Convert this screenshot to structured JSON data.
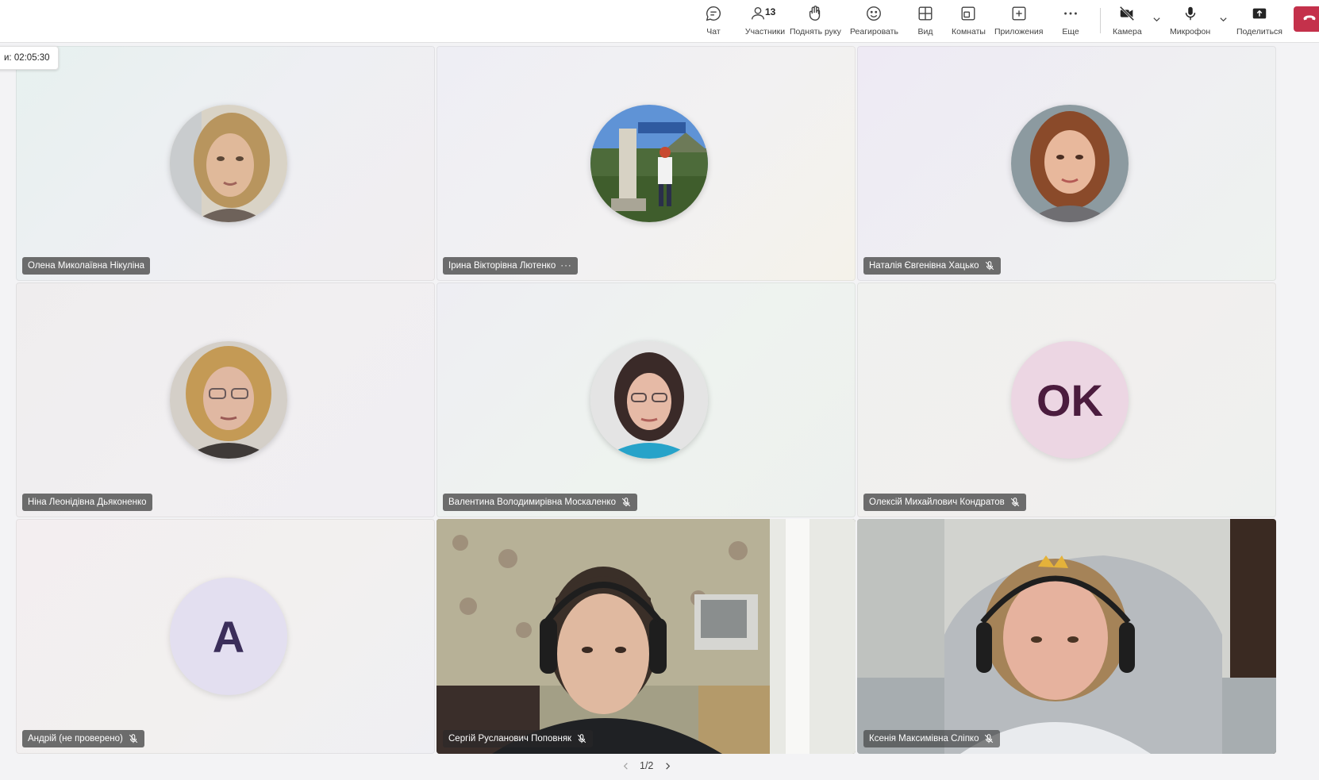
{
  "toolbar": {
    "chat": {
      "label": "Чат",
      "icon": "chat-icon"
    },
    "participants": {
      "label": "Участники",
      "count": "13",
      "icon": "people-icon"
    },
    "raise_hand": {
      "label": "Поднять руку",
      "icon": "hand-icon"
    },
    "react": {
      "label": "Реагировать",
      "icon": "smiley-icon"
    },
    "view": {
      "label": "Вид",
      "icon": "grid-icon"
    },
    "rooms": {
      "label": "Комнаты",
      "icon": "rooms-icon"
    },
    "apps": {
      "label": "Приложения",
      "icon": "plus-square-icon"
    },
    "more": {
      "label": "Еще",
      "icon": "more-icon"
    },
    "camera": {
      "label": "Камера",
      "icon": "camera-off-icon"
    },
    "mic": {
      "label": "Микрофон",
      "icon": "microphone-icon"
    },
    "share": {
      "label": "Поделиться",
      "icon": "share-icon"
    },
    "leave_color": "#c4314b"
  },
  "timer": {
    "text": "и: 02:05:30"
  },
  "participants": [
    {
      "name": "Олена Миколаївна Нікуліна",
      "type": "photo",
      "muted": false,
      "more": false
    },
    {
      "name": "Ірина Вікторівна Лютенко",
      "type": "photo",
      "muted": false,
      "more": true,
      "more_glyph": "···"
    },
    {
      "name": "Наталія Євгенівна Хацько",
      "type": "photo",
      "muted": true,
      "more": false
    },
    {
      "name": "Ніна Леонідівна Дьяконенко",
      "type": "photo",
      "muted": false,
      "more": false
    },
    {
      "name": "Валентина Володимирівна Москаленко",
      "type": "photo",
      "muted": true,
      "more": false
    },
    {
      "name": "Олексій Михайлович Кондратов",
      "type": "initials",
      "initials": "OK",
      "avatar_bg": "#ecd6e3",
      "initials_color": "#4b1c3e",
      "muted": true,
      "more": false
    },
    {
      "name": "Андрій (не проверено)",
      "type": "initials",
      "initials": "A",
      "avatar_bg": "#e3dff0",
      "initials_color": "#3b2e5a",
      "muted": true,
      "more": false
    },
    {
      "name": "Сергій Русланович Поповняк",
      "type": "video",
      "muted": true,
      "more": false
    },
    {
      "name": "Ксенія Максимівна Сліпко",
      "type": "video",
      "muted": true,
      "more": false
    }
  ],
  "pager": {
    "text": "1/2"
  }
}
